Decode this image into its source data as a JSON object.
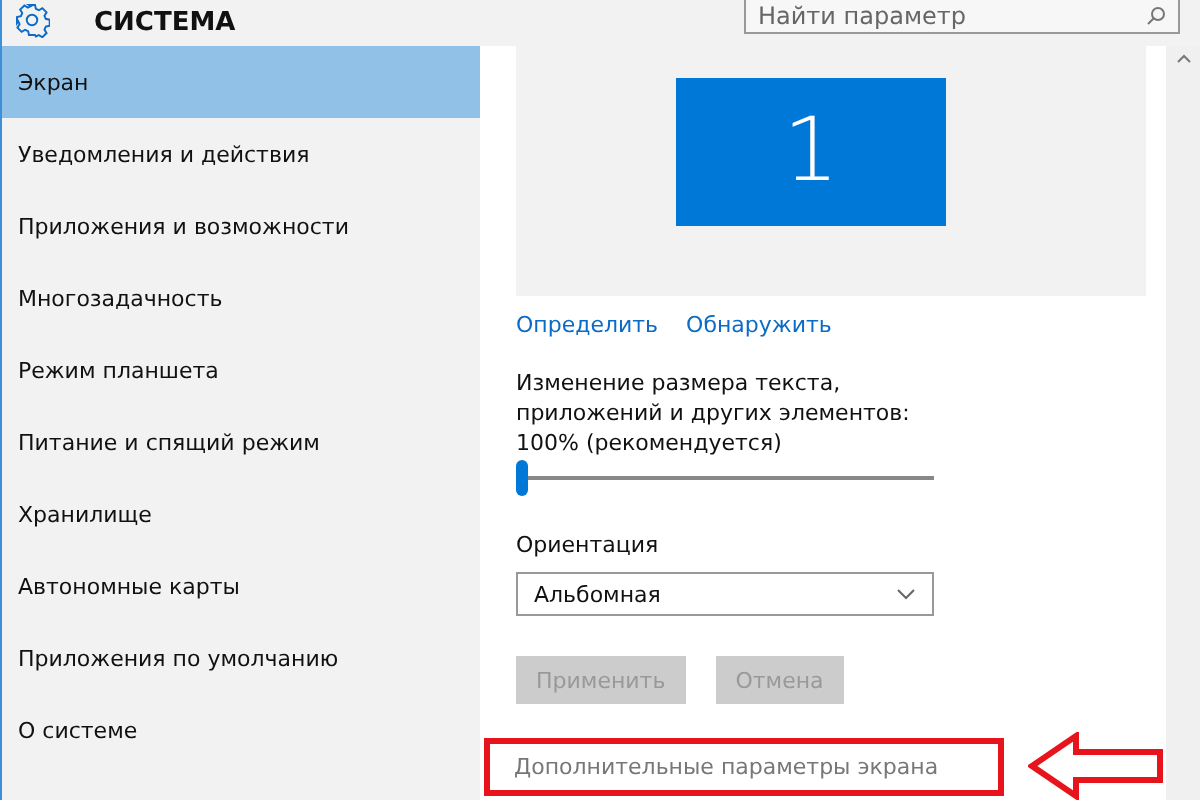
{
  "header": {
    "title": "СИСТЕМА",
    "search": {
      "placeholder": "Найти параметр"
    }
  },
  "sidebar": {
    "items": [
      {
        "label": "Экран",
        "selected": true
      },
      {
        "label": "Уведомления и действия",
        "selected": false
      },
      {
        "label": "Приложения и возможности",
        "selected": false
      },
      {
        "label": "Многозадачность",
        "selected": false
      },
      {
        "label": "Режим планшета",
        "selected": false
      },
      {
        "label": "Питание и спящий режим",
        "selected": false
      },
      {
        "label": "Хранилище",
        "selected": false
      },
      {
        "label": "Автономные карты",
        "selected": false
      },
      {
        "label": "Приложения по умолчанию",
        "selected": false
      },
      {
        "label": "О системе",
        "selected": false
      }
    ]
  },
  "display": {
    "monitor_number": "1",
    "links": [
      "Определить",
      "Обнаружить"
    ]
  },
  "scale": {
    "label": "Изменение размера текста, приложений и других элементов: 100% (рекомендуется)",
    "level": 0
  },
  "orientation": {
    "label": "Ориентация",
    "value": "Альбомная"
  },
  "buttons": [
    {
      "label": "Применить",
      "disabled": true
    },
    {
      "label": "Отмена",
      "disabled": true
    }
  ],
  "advanced_link": {
    "label": "Дополнительные параметры экрана",
    "highlighted": true
  }
}
